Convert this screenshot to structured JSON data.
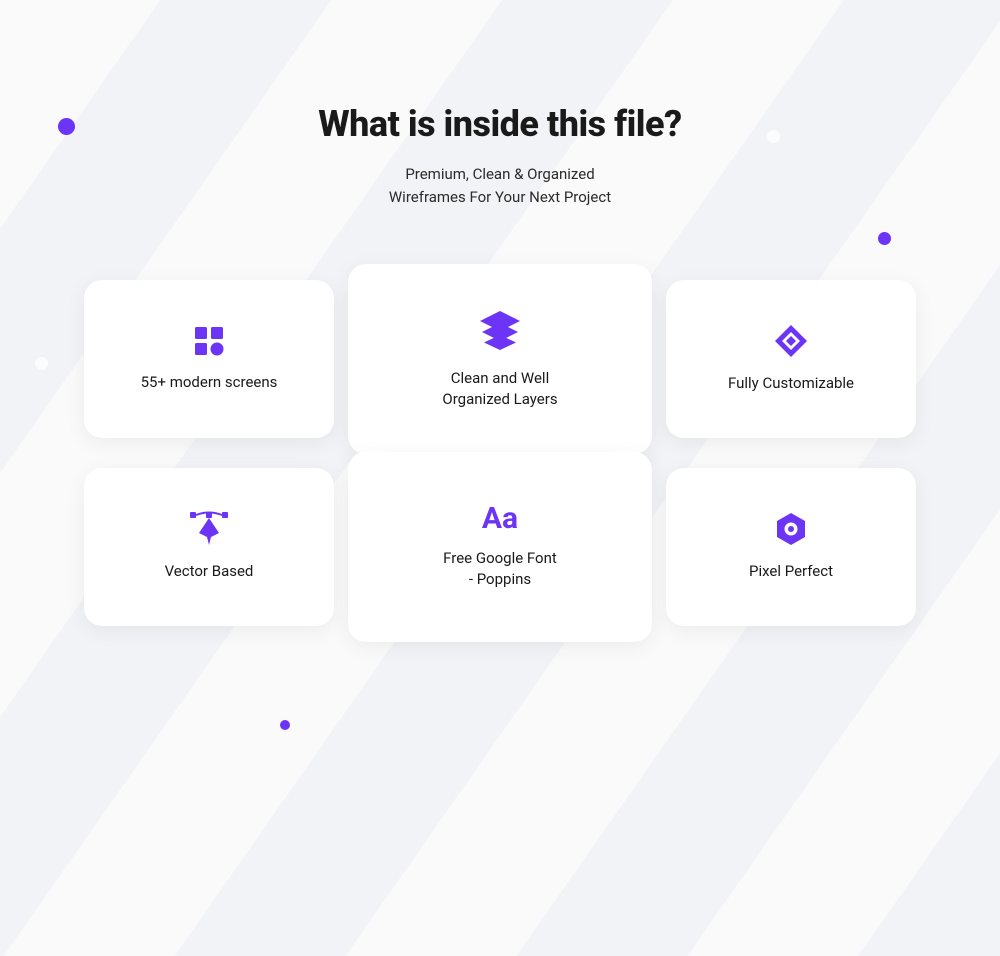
{
  "title": "What is inside this file?",
  "subtitle": {
    "line1": "Premium, Clean & Organized",
    "line2": "Wireframes For Your Next Project"
  },
  "accent_color": "#6c34f5",
  "cards": {
    "c0": {
      "label": "55+ modern screens"
    },
    "c1": {
      "label_line1": "Clean and Well",
      "label_line2": "Organized Layers"
    },
    "c2": {
      "label": "Fully Customizable"
    },
    "c3": {
      "label": "Vector Based"
    },
    "c4": {
      "glyph": "Aa",
      "label_line1": "Free Google Font",
      "label_line2": "- Poppins"
    },
    "c5": {
      "label": "Pixel Perfect"
    }
  }
}
